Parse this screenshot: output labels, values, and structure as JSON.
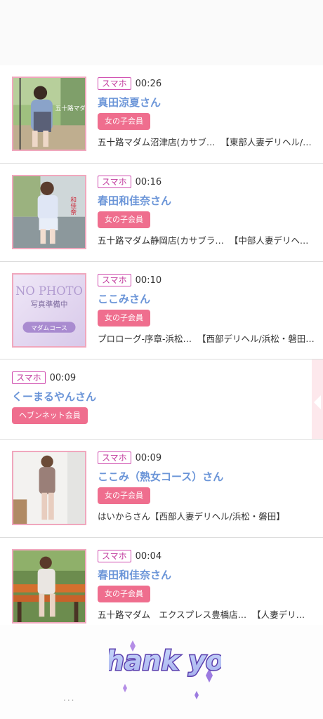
{
  "rows": [
    {
      "device": "スマホ",
      "time": "00:26",
      "name": "真田涼夏さん",
      "badge": "女の子会員",
      "shop": "五十路マダム沼津店(カサブ…",
      "area": "【東部人妻デリヘル/…",
      "photo": "photo",
      "thumb_text": "五十路マダム"
    },
    {
      "device": "スマホ",
      "time": "00:16",
      "name": "春田和佳奈さん",
      "badge": "女の子会員",
      "shop": "五十路マダム静岡店(カサブラ…",
      "area": "【中部人妻デリヘ…",
      "photo": "photo",
      "thumb_text": "和佳奈"
    },
    {
      "device": "スマホ",
      "time": "00:10",
      "name": "ここみさん",
      "badge": "女の子会員",
      "shop": "プロローグ-序章-浜松…",
      "area": "【西部デリヘル/浜松・磐田…",
      "photo": "nophoto",
      "thumb_text": "NO PHOTO",
      "thumb_text2": "写真準備中",
      "thumb_text3": "マダムコース"
    },
    {
      "device": "スマホ",
      "time": "00:09",
      "name": "くーまるやんさん",
      "badge": "ヘブンネット会員",
      "shop": "",
      "area": "",
      "photo": "none"
    },
    {
      "device": "スマホ",
      "time": "00:09",
      "name": "ここみ（熟女コース）さん",
      "badge": "女の子会員",
      "shop": "はいからさん",
      "area": "【西部人妻デリヘル/浜松・磐田】",
      "photo": "photo"
    },
    {
      "device": "スマホ",
      "time": "00:04",
      "name": "春田和佳奈さん",
      "badge": "女の子会員",
      "shop": "五十路マダム　エクスプレス豊橋店…",
      "area": "【人妻デリ…",
      "photo": "photo"
    }
  ],
  "footer": {
    "sticker_text": "Thank you",
    "dots": "..."
  },
  "colors": {
    "accent": "#6b95d8",
    "badge": "#ef6e8e",
    "device_border": "#d04fb0"
  }
}
